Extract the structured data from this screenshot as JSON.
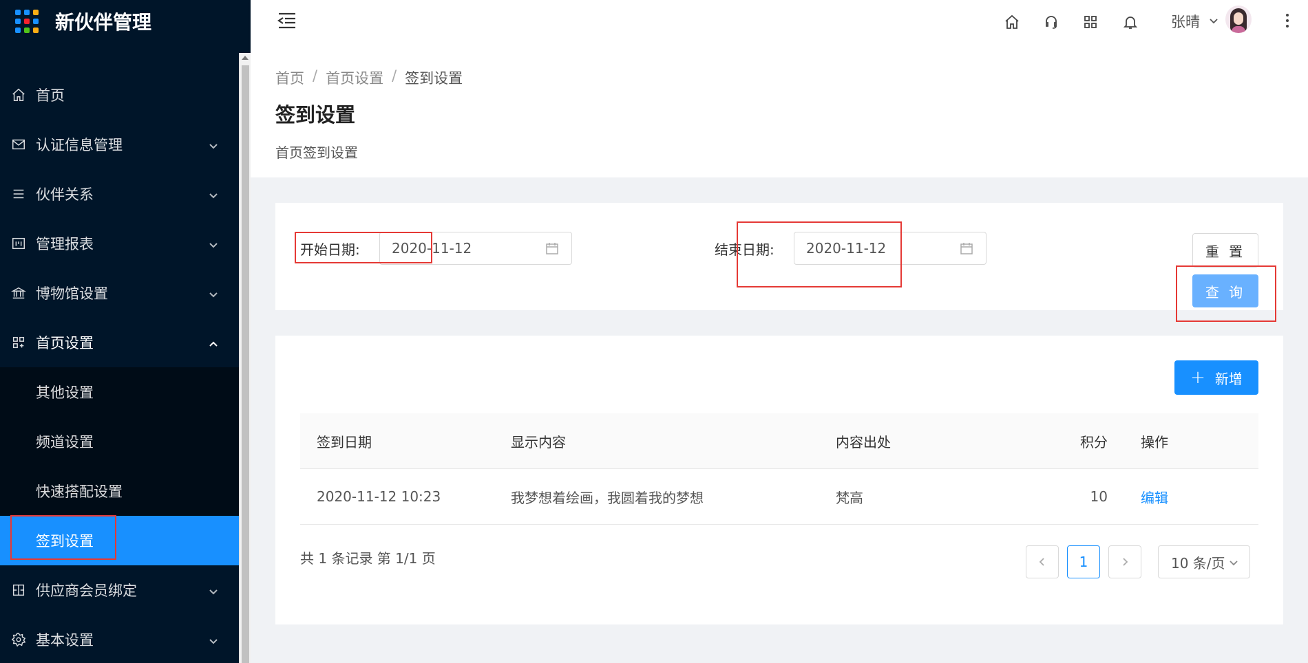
{
  "app": {
    "title": "新伙伴管理"
  },
  "sidebar": {
    "items": [
      {
        "label": "首页",
        "icon": "home-icon"
      },
      {
        "label": "认证信息管理",
        "icon": "mail-icon"
      },
      {
        "label": "伙伴关系",
        "icon": "list-icon"
      },
      {
        "label": "管理报表",
        "icon": "report-icon"
      },
      {
        "label": "博物馆设置",
        "icon": "bank-icon"
      },
      {
        "label": "首页设置",
        "icon": "appstore-icon",
        "expanded": true
      }
    ],
    "sub_items": [
      {
        "label": "其他设置"
      },
      {
        "label": "频道设置"
      },
      {
        "label": "快速搭配设置"
      },
      {
        "label": "签到设置",
        "active": true
      }
    ],
    "bottom_items": [
      {
        "label": "供应商会员绑定",
        "icon": "bind-icon"
      },
      {
        "label": "基本设置",
        "icon": "setting-icon"
      }
    ],
    "active_color": "#1890ff",
    "bg_color": "#001529"
  },
  "header": {
    "user_name": "张晴",
    "icons": [
      "home-icon",
      "headset-icon",
      "appstore-icon",
      "bell-icon",
      "more-icon"
    ]
  },
  "page": {
    "breadcrumb": [
      "首页",
      "首页设置",
      "签到设置"
    ],
    "title": "签到设置",
    "description": "首页签到设置"
  },
  "search": {
    "start_label": "开始日期:",
    "start_value": "2020-11-12",
    "end_label": "结束日期:",
    "end_value": "2020-11-12",
    "reset_label": "重 置",
    "query_label": "查 询"
  },
  "table": {
    "add_label": "新增",
    "columns": [
      "签到日期",
      "显示内容",
      "内容出处",
      "积分",
      "操作"
    ],
    "rows": [
      {
        "date": "2020-11-12 10:23",
        "content": "我梦想着绘画，我圆着我的梦想",
        "source": "梵高",
        "points": "10",
        "action": "编辑"
      }
    ]
  },
  "pagination": {
    "total_text": "共 1 条记录 第 1/1 页",
    "current_page": "1",
    "page_size": "10 条/页"
  }
}
